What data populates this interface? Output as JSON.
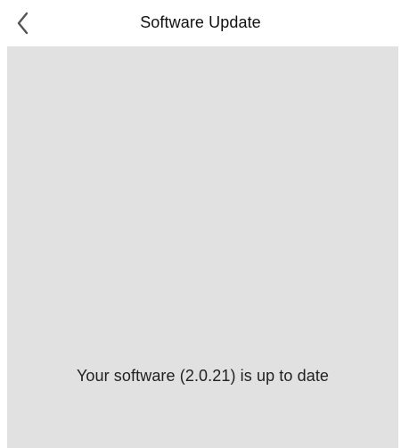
{
  "nav": {
    "title": "Software Update",
    "back_icon": "chevron-left-icon"
  },
  "content": {
    "status_text": "Your software (2.0.21) is up to date"
  },
  "colors": {
    "panel_background": "#e1e1e1",
    "icon_color": "#555555",
    "text_color": "#222222"
  }
}
